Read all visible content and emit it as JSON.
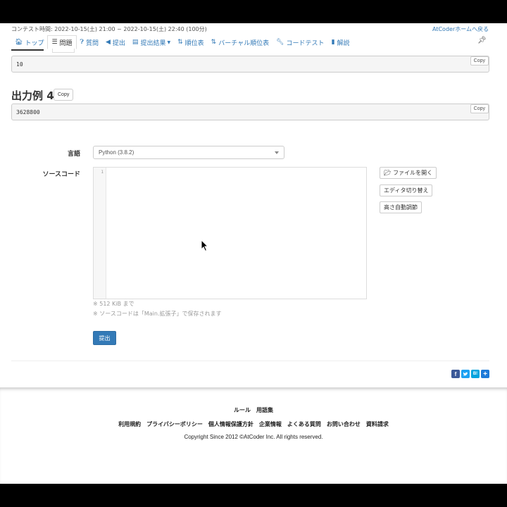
{
  "header": {
    "contest_time": "コンテスト時間: 2022-10-15(土) 21:00 ~ 2022-10-15(土) 22:40 (100分)",
    "back_link": "AtCoderホームへ戻る"
  },
  "nav": {
    "items": [
      {
        "label": "トップ",
        "icon": "home-icon"
      },
      {
        "label": "問題",
        "icon": "list-icon",
        "active": true
      },
      {
        "label": "質問",
        "icon": "question-icon"
      },
      {
        "label": "提出",
        "icon": "send-icon"
      },
      {
        "label": "提出結果",
        "icon": "results-icon",
        "dropdown": true
      },
      {
        "label": "順位表",
        "icon": "sort-icon"
      },
      {
        "label": "バーチャル順位表",
        "icon": "sort-icon"
      },
      {
        "label": "コードテスト",
        "icon": "wrench-icon"
      },
      {
        "label": "解説",
        "icon": "book-icon"
      }
    ],
    "pin_icon": "pin-icon"
  },
  "samples": {
    "input_value": "10",
    "output_heading": "出力例 4",
    "output_value": "3628800",
    "copy_label": "Copy"
  },
  "form": {
    "language_label": "言語",
    "language_value": "Python (3.8.2)",
    "source_label": "ソースコード",
    "line_number": "1",
    "open_file": "ファイルを開く",
    "toggle_editor": "エディタ切り替え",
    "auto_height": "高さ自動調節",
    "note_size": "※ 512 KiB まで",
    "note_filename": "※ ソースコードは「Main.拡張子」で保存されます",
    "submit": "提出"
  },
  "share": {
    "colors": {
      "facebook": "#3b5998",
      "twitter": "#1da1f2",
      "hatena": "#00a4de",
      "addthis": "#1e7ad8"
    },
    "facebook": "f",
    "hatena": "B!",
    "more": "+"
  },
  "footer": {
    "row1": [
      "ルール",
      "用語集"
    ],
    "row2": [
      "利用規約",
      "プライバシーポリシー",
      "個人情報保護方針",
      "企業情報",
      "よくある質問",
      "お問い合わせ",
      "資料請求"
    ],
    "copyright": "Copyright Since 2012 ©AtCoder Inc. All rights reserved."
  },
  "colors": {
    "accent": "#337ab7"
  }
}
